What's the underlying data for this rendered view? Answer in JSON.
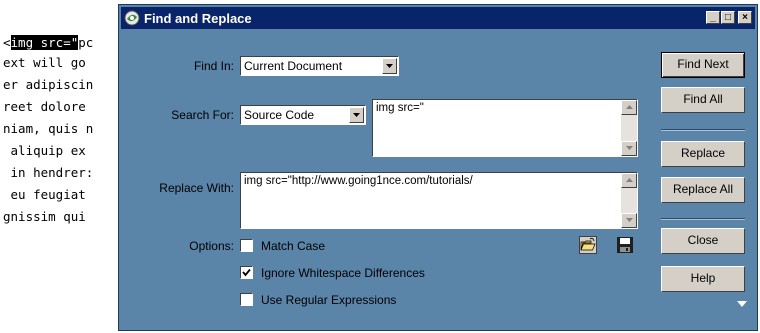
{
  "editor": {
    "lines": [
      {
        "pre": "<",
        "selected": "img src=\"",
        "post": "pc"
      },
      {
        "pre": "ext will go",
        "selected": "",
        "post": ""
      },
      {
        "pre": "er adipiscin",
        "selected": "",
        "post": ""
      },
      {
        "pre": "reet dolore",
        "selected": "",
        "post": ""
      },
      {
        "pre": "niam, quis n",
        "selected": "",
        "post": ""
      },
      {
        "pre": " aliquip ex",
        "selected": "",
        "post": ""
      },
      {
        "pre": " in hendrer:",
        "selected": "",
        "post": ""
      },
      {
        "pre": " eu feugiat",
        "selected": "",
        "post": ""
      },
      {
        "pre": "gnissim qui",
        "selected": "",
        "post": ""
      }
    ]
  },
  "dialog": {
    "title": "Find and Replace",
    "window_buttons": {
      "minimize": "_",
      "maximize": "□",
      "close": "×"
    },
    "find_in": {
      "label": "Find In:",
      "value": "Current Document"
    },
    "search_for": {
      "label": "Search For:",
      "type_value": "Source Code",
      "text": "img src=\""
    },
    "replace_with": {
      "label": "Replace With:",
      "text": "img src=\"http://www.going1nce.com/tutorials/"
    },
    "options": {
      "label": "Options:",
      "match_case": {
        "label": "Match Case",
        "checked": false
      },
      "ignore_whitespace": {
        "label": "Ignore Whitespace Differences",
        "checked": true
      },
      "regex": {
        "label": "Use Regular Expressions",
        "checked": false
      }
    },
    "buttons": {
      "find_next": "Find Next",
      "find_all": "Find All",
      "replace": "Replace",
      "replace_all": "Replace All",
      "close": "Close",
      "help": "Help"
    },
    "icons": {
      "open": "open-folder-icon",
      "save": "save-disk-icon",
      "expand": "triangle-down-icon"
    },
    "colors": {
      "dialog_bg": "#5a84a8",
      "titlebar": "#0a246a",
      "button_face": "#d4d0c8"
    }
  }
}
